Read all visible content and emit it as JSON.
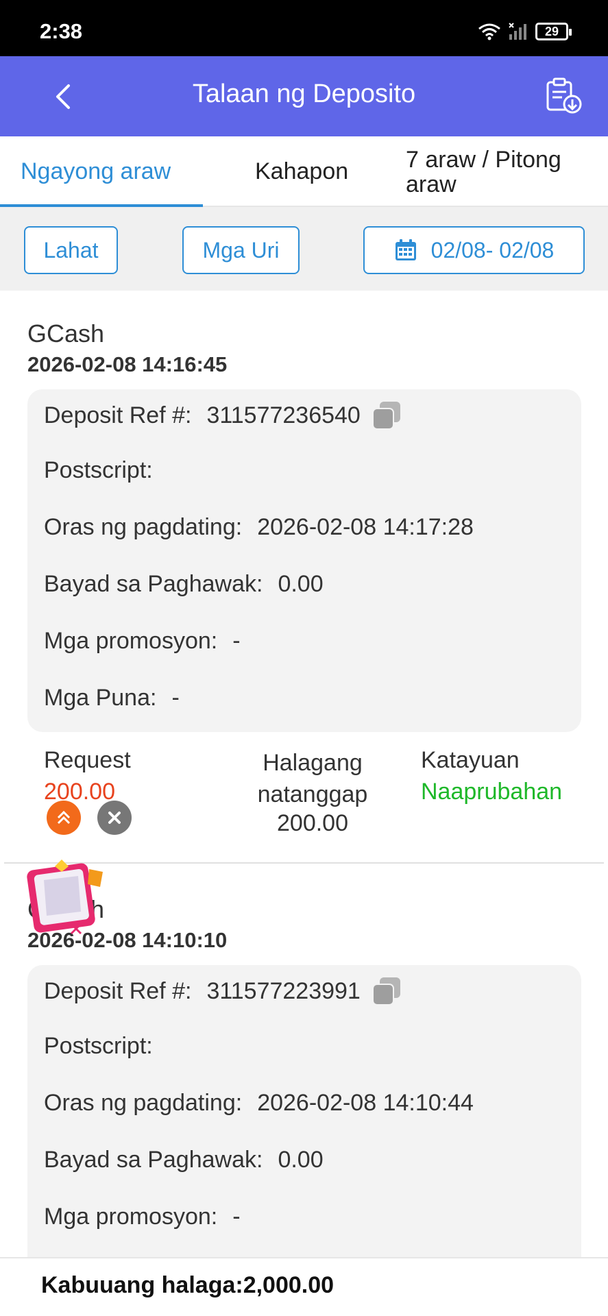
{
  "status_bar": {
    "time": "2:38",
    "battery": "29"
  },
  "header": {
    "title": "Talaan ng Deposito",
    "back_icon": "chevron-left-icon",
    "action_icon": "clipboard-download-icon"
  },
  "tabs": [
    {
      "label": "Ngayong araw",
      "active": true
    },
    {
      "label": "Kahapon",
      "active": false
    },
    {
      "label": "7 araw / Pitong araw",
      "active": false
    }
  ],
  "filters": {
    "all": "Lahat",
    "types": "Mga Uri",
    "date_range": "02/08- 02/08"
  },
  "records": [
    {
      "method": "GCash",
      "datetime": "2026-02-08 14:16:45",
      "ref_label": "Deposit Ref #:",
      "ref": "311577236540",
      "postscript_label": "Postscript:",
      "arrival_label": "Oras ng pagdating:",
      "arrival": "2026-02-08 14:17:28",
      "fee_label": "Bayad sa Paghawak:",
      "fee": "0.00",
      "promo_label": "Mga promosyon:",
      "promo": "-",
      "remarks_label": "Mga Puna:",
      "remarks": "-",
      "request_label": "Request",
      "request_amount": "200.00",
      "received_label": "Halagang natanggap",
      "received_amount": "200.00",
      "status_label": "Katayuan",
      "status": "Naaprubahan"
    },
    {
      "method": "GCash",
      "datetime": "2026-02-08 14:10:10",
      "ref_label": "Deposit Ref #:",
      "ref": "311577223991",
      "postscript_label": "Postscript:",
      "arrival_label": "Oras ng pagdating:",
      "arrival": "2026-02-08 14:10:44",
      "fee_label": "Bayad sa Paghawak:",
      "fee": "0.00",
      "promo_label": "Mga promosyon:",
      "promo": "-"
    }
  ],
  "footer": {
    "total": "Kabuuang halaga:2,000.00"
  },
  "colors": {
    "header": "#5f66e8",
    "accent": "#2e8ed6",
    "request": "#e8431e",
    "approved": "#1eb829"
  }
}
